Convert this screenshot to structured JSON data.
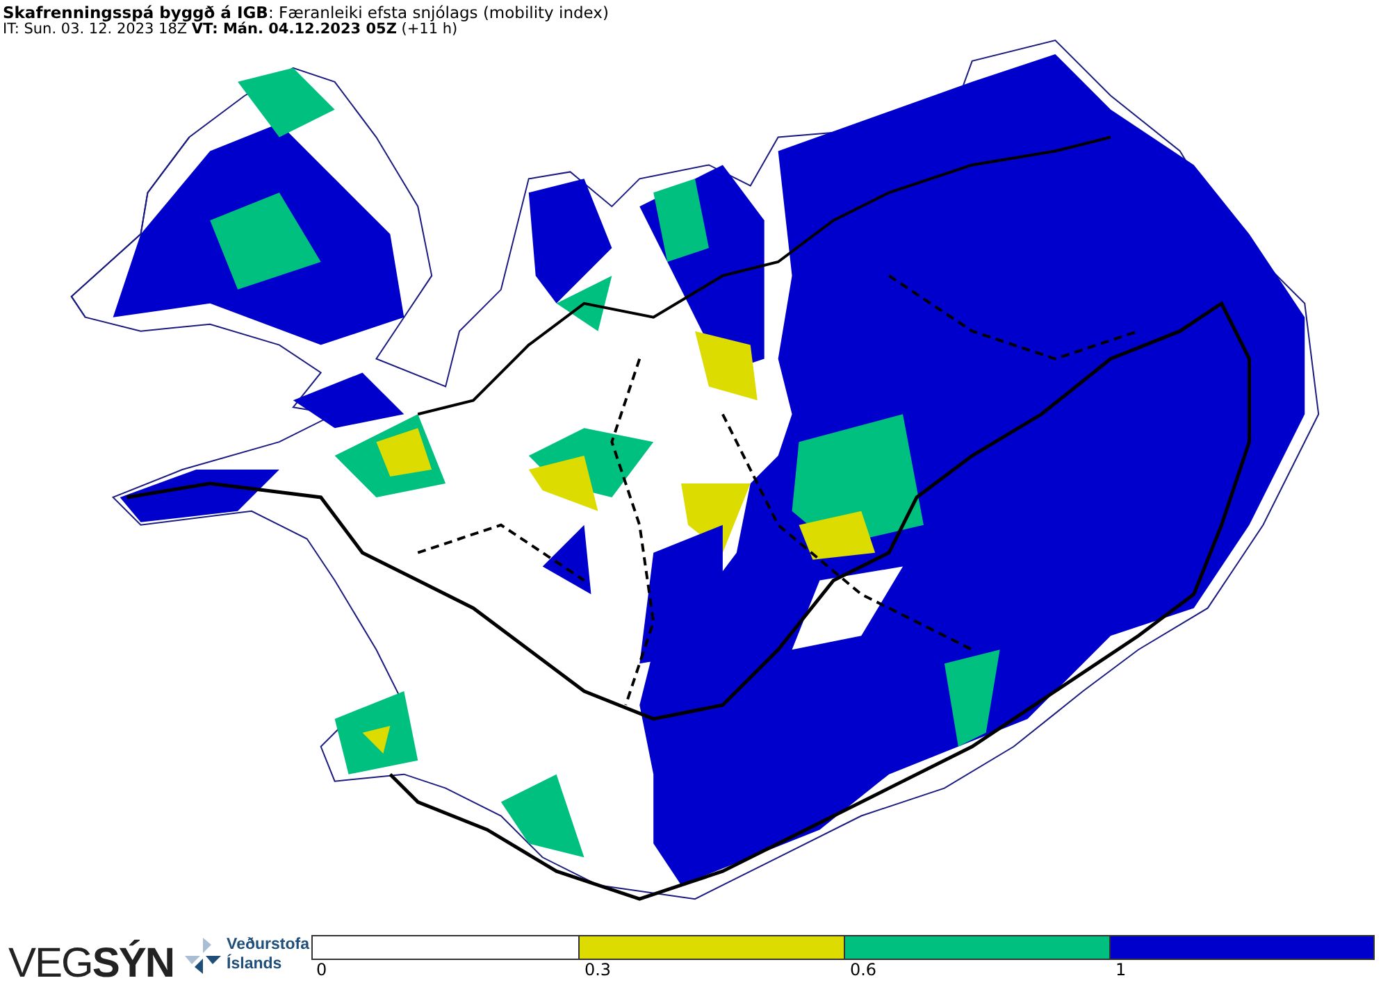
{
  "header": {
    "title": "**Skafrenningsspá byggð á IGB**: Færanleiki efsta snjólags (mobility index)",
    "times": "IT: Sun. 03. 12. 2023 18Z **VT: Mán. 04.12.2023 05Z** (+11 h)"
  },
  "logos": {
    "brand": "VEG**SÝN**",
    "agency_lines": [
      "Veðurstofa",
      "Íslands"
    ]
  },
  "legend": [
    {
      "label": "0",
      "color": "#ffffff"
    },
    {
      "label": "0.3",
      "color": "#dcdc00"
    },
    {
      "label": "0.6",
      "color": "#00c080"
    },
    {
      "label": "1",
      "color": "#0000cc"
    }
  ]
}
